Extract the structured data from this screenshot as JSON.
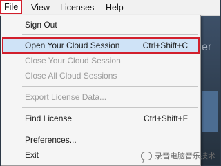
{
  "menubar": {
    "items": [
      {
        "label": "File"
      },
      {
        "label": "View"
      },
      {
        "label": "Licenses"
      },
      {
        "label": "Help"
      }
    ]
  },
  "background_app": {
    "partial_text": "er"
  },
  "menu": {
    "items": [
      {
        "label": "Sign Out",
        "shortcut": "",
        "enabled": true
      },
      {
        "label": "Open Your Cloud Session",
        "shortcut": "Ctrl+Shift+C",
        "enabled": true,
        "highlighted": true
      },
      {
        "label": "Close Your Cloud Session",
        "shortcut": "",
        "enabled": false
      },
      {
        "label": "Close All Cloud Sessions",
        "shortcut": "",
        "enabled": false
      },
      {
        "label": "Export License Data...",
        "shortcut": "",
        "enabled": false
      },
      {
        "label": "Find License",
        "shortcut": "Ctrl+Shift+F",
        "enabled": true
      },
      {
        "label": "Preferences...",
        "shortcut": "",
        "enabled": true
      },
      {
        "label": "Exit",
        "shortcut": "",
        "enabled": true
      }
    ]
  },
  "watermark": {
    "text": "录音电脑音乐技术"
  },
  "colors": {
    "highlight_fill": "#cfe3f7",
    "annotation_red": "#d21f2c",
    "disabled_text": "#9b9b9b"
  }
}
